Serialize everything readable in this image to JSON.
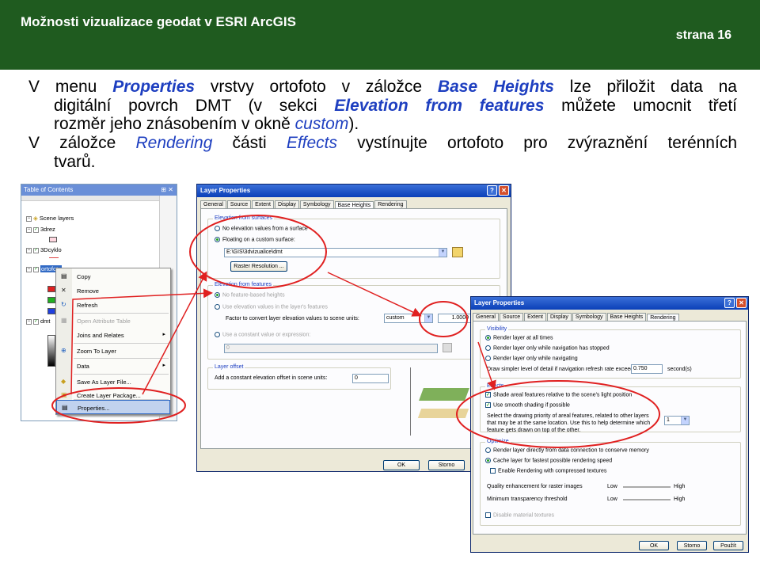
{
  "header": {
    "title": "Možnosti vizualizace geodat v ESRI ArcGIS",
    "page": "strana 16"
  },
  "text": {
    "p1_prefix": "V menu ",
    "p1_properties": "Properties",
    "p1_mid1": " vrstvy ortofoto v záložce ",
    "p1_base_heights": "Base Heights",
    "p1_mid2": " lze přiložit data na",
    "p2_prefix": "digitální povrch DMT (v sekci ",
    "p2_elev": "Elevation from features",
    "p2_suffix": " můžete umocnit třetí",
    "p3_prefix": "rozměr jeho znásobením v okně ",
    "p3_custom": "custom",
    "p3_suffix": ").",
    "p4_prefix": "V záložce ",
    "p4_rendering": "Rendering",
    "p4_mid": " části ",
    "p4_effects": "Effects",
    "p4_suffix": " vystínujte ortofoto pro zvýraznění terénních",
    "p5": "tvarů."
  },
  "toc": {
    "title": "Table of Contents",
    "pin_glyph": "⊞ ✕",
    "root": "Scene layers",
    "layers": [
      "3drez",
      "3Dcyklo",
      "ortofoto",
      "dmt"
    ],
    "menu": {
      "items": [
        {
          "label": "Copy",
          "icon": "▤",
          "arrow": ""
        },
        {
          "label": "Remove",
          "icon": "✕",
          "arrow": ""
        },
        {
          "label": "Refresh",
          "icon": "↻",
          "arrow": ""
        },
        {
          "label": "Open Attribute Table",
          "icon": "▦",
          "arrow": ""
        },
        {
          "label": "Joins and Relates",
          "icon": "",
          "arrow": "▸"
        },
        {
          "label": "Zoom To Layer",
          "icon": "⊕",
          "arrow": ""
        },
        {
          "label": "Data",
          "icon": "",
          "arrow": "▸"
        },
        {
          "label": "Save As Layer File...",
          "icon": "◆",
          "arrow": ""
        },
        {
          "label": "Create Layer Package...",
          "icon": "▣",
          "arrow": ""
        },
        {
          "label": "Properties...",
          "icon": "▤",
          "arrow": ""
        }
      ],
      "disabled_index": 3,
      "selected_index": 9
    }
  },
  "dlg1": {
    "title": "Layer Properties",
    "tabs": [
      "General",
      "Source",
      "Extent",
      "Display",
      "Symbology",
      "Base Heights",
      "Rendering"
    ],
    "active_tab": "Base Heights",
    "elev_surfaces": {
      "legend": "Elevation from surfaces",
      "opt1": "No elevation values from a surface",
      "opt2": "Floating on a custom surface:",
      "path": "E:\\GIS\\3dvizualice\\dmt",
      "raster_btn": "Raster Resolution ..."
    },
    "elev_features": {
      "legend": "Elevation from features",
      "opt1": "No feature-based heights",
      "opt2": "Use elevation values in the layer's features",
      "factor_label": "Factor to convert layer elevation values to scene units:",
      "factor_select": "custom",
      "factor_value": "1.0000",
      "opt3": "Use a constant value or expression:",
      "const_value": "0"
    },
    "layer_offset": {
      "legend": "Layer offset",
      "label": "Add a constant elevation offset in scene units:",
      "value": "0"
    },
    "ok": "OK",
    "cancel": "Storno"
  },
  "dlg2": {
    "title": "Layer Properties",
    "tabs": [
      "General",
      "Source",
      "Extent",
      "Display",
      "Symbology",
      "Base Heights",
      "Rendering"
    ],
    "active_tab": "Rendering",
    "visibility": {
      "legend": "Visibility",
      "c1": "Render layer at all times",
      "c2": "Render layer only while navigation has stopped",
      "c3": "Render layer only while navigating",
      "detail_label": "Draw simpler level of detail if navigation refresh rate exceeds:",
      "detail_value": "0.750",
      "detail_unit": "second(s)"
    },
    "effects": {
      "legend": "Effects",
      "c1": "Shade areal features relative to the scene's light position",
      "c2": "Use smooth shading if possible",
      "priority_text": "Select the drawing priority of areal features, related to other layers that may be at the same location. Use this to help determine which feature gets drawn on top of the other.",
      "priority_value": "1"
    },
    "optimize": {
      "legend": "Optimize",
      "c1": "Render layer directly from data connection to conserve memory",
      "c2": "Cache layer for fastest possible rendering speed",
      "c3": "Enable Rendering with compressed textures",
      "q1": "Quality enhancement for raster images",
      "q2": "Minimum transparency threshold",
      "low": "Low",
      "high": "High",
      "c4": "Disable material textures"
    },
    "ok": "OK",
    "cancel": "Storno",
    "apply": "Použít"
  },
  "colors": {
    "header_bg": "#1f5b1f",
    "emphasis": "#1e3fc0",
    "annotation": "#e02020"
  }
}
